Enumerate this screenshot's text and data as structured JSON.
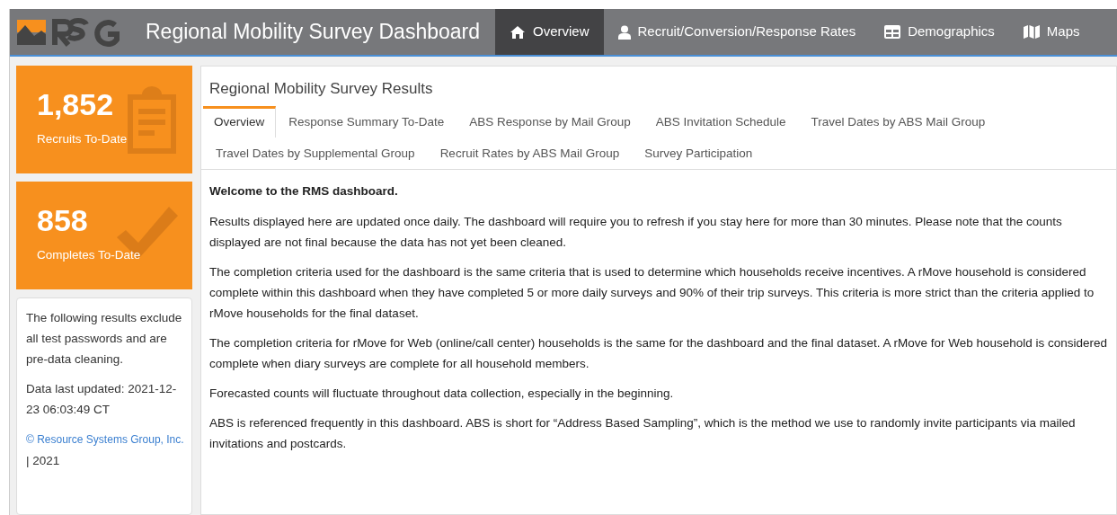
{
  "header": {
    "title": "Regional Mobility Survey Dashboard"
  },
  "nav": [
    {
      "label": "Overview",
      "kind": "home",
      "selected": true
    },
    {
      "label": "Recruit/Conversion/Response Rates",
      "kind": "user",
      "selected": false
    },
    {
      "label": "Demographics",
      "kind": "table",
      "selected": false
    },
    {
      "label": "Maps",
      "kind": "map",
      "selected": false
    }
  ],
  "stats": [
    {
      "value": "1,852",
      "label": "Recruits To-Date",
      "kind": "clipboard"
    },
    {
      "value": "858",
      "label": "Completes To-Date",
      "kind": "check"
    }
  ],
  "note": {
    "text": "The following results exclude all test passwords and are pre-data cleaning.",
    "updated": "Data last updated: 2021-12-23 06:03:49 CT",
    "link": "© Resource Systems Group, Inc.",
    "year": "| 2021"
  },
  "panel": {
    "title": "Regional Mobility Survey Results",
    "tabs": [
      {
        "label": "Overview",
        "selected": true
      },
      {
        "label": "Response Summary To-Date",
        "selected": false
      },
      {
        "label": "ABS Response by Mail Group",
        "selected": false
      },
      {
        "label": "ABS Invitation Schedule",
        "selected": false
      },
      {
        "label": "Travel Dates by ABS Mail Group",
        "selected": false
      },
      {
        "label": "Travel Dates by Supplemental Group",
        "selected": false
      },
      {
        "label": "Recruit Rates by ABS Mail Group",
        "selected": false
      },
      {
        "label": "Survey Participation",
        "selected": false
      }
    ],
    "heading": "Welcome to the RMS dashboard.",
    "paragraphs": [
      "Results displayed here are updated once daily. The dashboard will require you to refresh if you stay here for more than 30 minutes. Please note that the counts displayed are not final because the data has not yet been cleaned.",
      "The completion criteria used for the dashboard is the same criteria that is used to determine which households receive incentives. A rMove household is considered complete within this dashboard when they have completed 5 or more daily surveys and 90% of their trip surveys. This criteria is more strict than the criteria applied to rMove households for the final dataset.",
      "The completion criteria for rMove for Web (online/call center) households is the same for the dashboard and the final dataset. A rMove for Web household is considered complete when diary surveys are complete for all household members.",
      "Forecasted counts will fluctuate throughout data collection, especially in the beginning.",
      "ABS is referenced frequently in this dashboard. ABS is short for “Address Based Sampling”, which is the method we use to randomly invite participants via mailed invitations and postcards."
    ]
  }
}
